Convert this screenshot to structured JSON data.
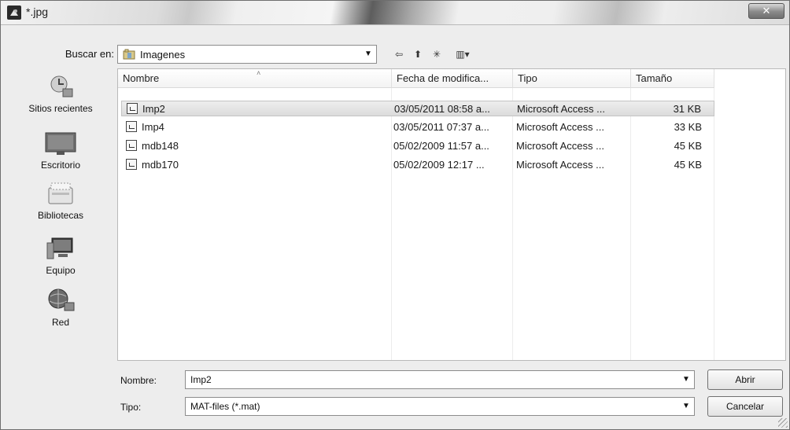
{
  "window": {
    "title": "*.jpg",
    "close_label": "✕"
  },
  "lookin": {
    "label": "Buscar en:",
    "value": "Imagenes"
  },
  "toolbar": {
    "back_glyph": "⇦",
    "up_glyph": "⬆",
    "newfolder_glyph": "✳",
    "views_glyph": "▥▾"
  },
  "places": [
    {
      "label": "Sitios recientes",
      "icon": "recent-places-icon"
    },
    {
      "label": "Escritorio",
      "icon": "desktop-icon"
    },
    {
      "label": "Bibliotecas",
      "icon": "libraries-icon"
    },
    {
      "label": "Equipo",
      "icon": "computer-icon"
    },
    {
      "label": "Red",
      "icon": "network-icon"
    }
  ],
  "columns": [
    "Nombre",
    "Fecha de modifica...",
    "Tipo",
    "Tamaño"
  ],
  "files": [
    {
      "name": "Imp2",
      "date": "03/05/2011 08:58 a...",
      "type": "Microsoft Access ...",
      "size": "31 KB",
      "selected": true
    },
    {
      "name": "Imp4",
      "date": "03/05/2011 07:37 a...",
      "type": "Microsoft Access ...",
      "size": "33 KB",
      "selected": false
    },
    {
      "name": "mdb148",
      "date": "05/02/2009 11:57 a...",
      "type": "Microsoft Access ...",
      "size": "45 KB",
      "selected": false
    },
    {
      "name": "mdb170",
      "date": "05/02/2009 12:17 ...",
      "type": "Microsoft Access ...",
      "size": "45 KB",
      "selected": false
    }
  ],
  "filename": {
    "label": "Nombre:",
    "value": "Imp2"
  },
  "filetype": {
    "label": "Tipo:",
    "value": "MAT-files (*.mat)"
  },
  "buttons": {
    "open": "Abrir",
    "cancel": "Cancelar"
  }
}
